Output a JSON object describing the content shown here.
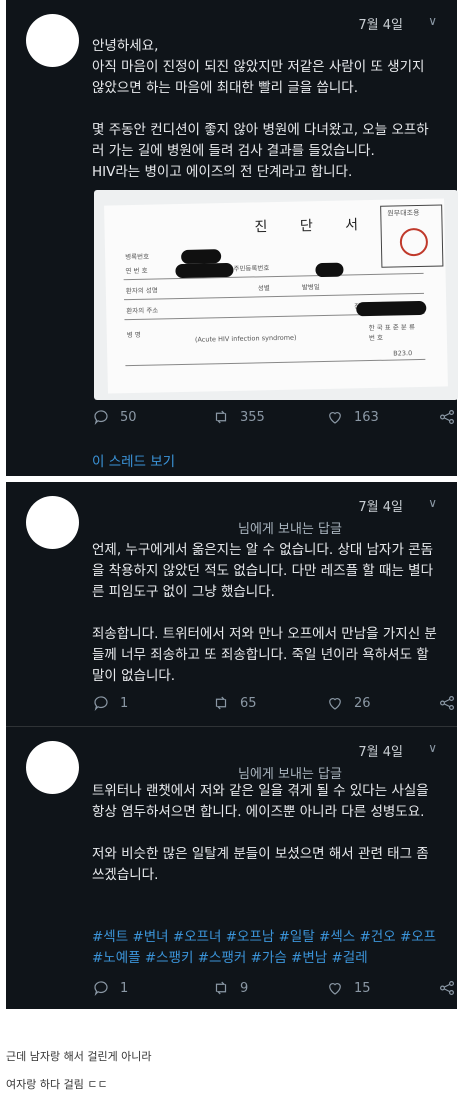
{
  "tweets": [
    {
      "date": "7월 4일",
      "reply_to": "",
      "text": "안녕하세요,\n아직 마음이 진정이 되진 않았지만 저같은 사람이 또 생기지 않았으면 하는 마음에 최대한 빨리 글을 씁니다.\n\n몇 주동안 컨디션이 좋지 않아 병원에 다녀왔고, 오늘 오프하러 가는 길에 병원에 들려 검사 결과를 들었습니다.\nHIV라는 병이고 에이즈의 전 단계라고 합니다.",
      "replies": "50",
      "retweets": "355",
      "likes": "163",
      "thread_link": "이 스레드 보기"
    },
    {
      "date": "7월 4일",
      "reply_to": "님에게 보내는 답글",
      "text": "언제, 누구에게서 옮은지는 알 수 없습니다. 상대 남자가 콘돔을 착용하지 않았던 적도 없습니다. 다만 레즈플 할 때는 별다른 피임도구 없이 그냥 했습니다.\n\n죄송합니다. 트위터에서 저와 만나 오프에서 만남을 가지신 분들께 너무 죄송하고 또 죄송합니다. 죽일 년이라 욕하셔도 할 말이 없습니다.",
      "replies": "1",
      "retweets": "65",
      "likes": "26"
    },
    {
      "date": "7월 4일",
      "reply_to": "님에게 보내는 답글",
      "text": "트위터나 랜챗에서 저와 같은 일을 겪게 될 수 있다는 사실을 항상 염두하셔으면 합니다. 에이즈뿐 아니라 다른 성병도요.\n\n저와 비슷한 많은 일탈계 분들이 보셨으면 해서 관련 태그 좀 쓰겠습니다.",
      "hashtags": "#섹트 #변녀 #오프녀 #오프남 #일탈 #섹스 #건오 #오프 #노예플 #스팽키 #스팽커 #가슴 #변남 #걸레",
      "replies": "1",
      "retweets": "9",
      "likes": "15"
    }
  ],
  "document": {
    "title": "진 단 서",
    "stamp_label": "원무대조용",
    "fields": [
      "병록번호",
      "연 번 호",
      "환자의 성명",
      "환자의 주소",
      "병 명",
      "발병일",
      "주민등록번호",
      "성별",
      "연령",
      "전 화",
      "(Acute HIV infection syndrome)",
      "한 국 표 준 분 류 번 호",
      "B23.0"
    ]
  },
  "captions": [
    "근데 남자랑 해서 걸린게 아니라",
    "여자랑 하다 걸림 ㄷㄷ"
  ],
  "colors": {
    "panel_bg": "#0f1419",
    "link": "#3b94d9",
    "muted": "#8b98a5"
  },
  "icons": [
    "reply-icon",
    "retweet-icon",
    "like-icon",
    "share-icon",
    "chevron-down-icon"
  ]
}
